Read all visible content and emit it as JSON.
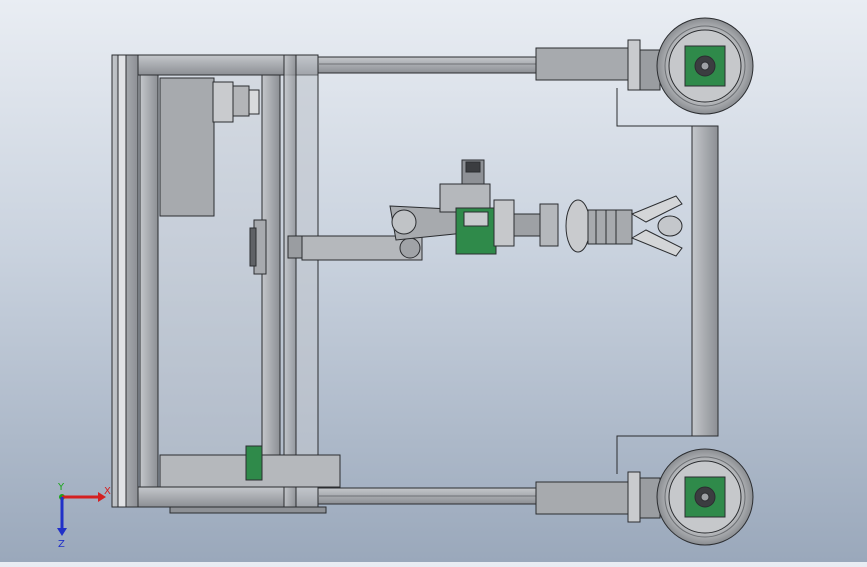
{
  "viewport": {
    "description_visible": "",
    "background_colors": [
      "#e9edf3",
      "#9aa8bb"
    ]
  },
  "triad": {
    "x_label": "X",
    "y_label": "Y",
    "z_label": "Z",
    "x_color": "#d42020",
    "y_color": "#1aa51a",
    "z_color": "#2030c8"
  },
  "colors": {
    "frame": "#9c9fa4",
    "frame_dark": "#5a5d62",
    "rail": "#8e9196",
    "part_gray": "#a7aaae",
    "bearing_green": "#2f8a4a",
    "wheel_tread": "#b8babd",
    "outline": "#2b2d30"
  }
}
